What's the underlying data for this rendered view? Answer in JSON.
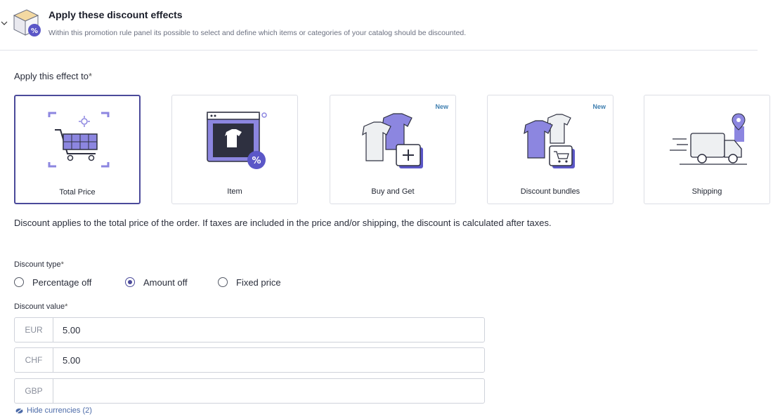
{
  "header": {
    "title": "Apply these discount effects",
    "subtitle": "Within this promotion rule panel its possible to select and define which items or categories of your catalog should be discounted."
  },
  "apply_effect": {
    "label": "Apply this effect to",
    "required_mark": "*",
    "cards": [
      {
        "label": "Total Price",
        "badge": "",
        "icon": "cart-icon",
        "selected": true
      },
      {
        "label": "Item",
        "badge": "",
        "icon": "tshirt-percent-icon",
        "selected": false
      },
      {
        "label": "Buy and Get",
        "badge": "New",
        "icon": "shirts-plus-icon",
        "selected": false
      },
      {
        "label": "Discount bundles",
        "badge": "New",
        "icon": "shirts-bag-icon",
        "selected": false
      },
      {
        "label": "Shipping",
        "badge": "",
        "icon": "truck-icon",
        "selected": false
      }
    ]
  },
  "description": "Discount applies to the total price of the order. If taxes are included in the price and/or shipping, the discount is calculated after taxes.",
  "discount_type": {
    "label": "Discount type",
    "required_mark": "*",
    "options": [
      {
        "label": "Percentage off",
        "checked": false
      },
      {
        "label": "Amount off",
        "checked": true
      },
      {
        "label": "Fixed price",
        "checked": false
      }
    ]
  },
  "discount_value": {
    "label": "Discount value",
    "required_mark": "*",
    "currencies": [
      {
        "code": "EUR",
        "value": "5.00"
      },
      {
        "code": "CHF",
        "value": "5.00"
      },
      {
        "code": "GBP",
        "value": ""
      }
    ]
  },
  "hide_currencies_link": "Hide currencies (2)",
  "colors": {
    "accent": "#4b4a9a",
    "illustration_purple": "#8c86e0",
    "badge": "#3f7fb0",
    "link": "#4b6aa8"
  }
}
